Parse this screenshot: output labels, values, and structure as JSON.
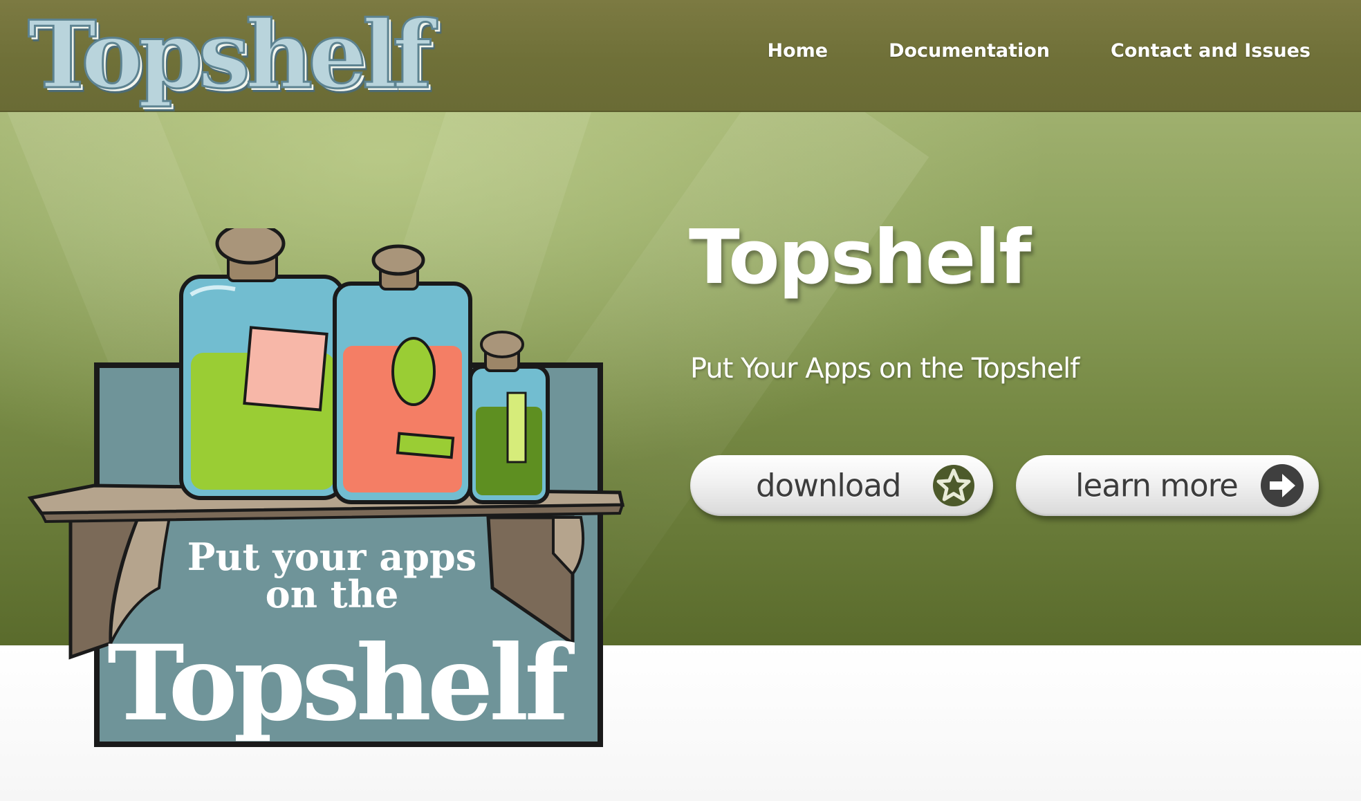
{
  "header": {
    "logo_text": "Topshelf",
    "nav": [
      {
        "label": "Home",
        "active": true
      },
      {
        "label": "Documentation",
        "active": false
      },
      {
        "label": "Contact and Issues",
        "active": false
      }
    ]
  },
  "hero": {
    "title": "Topshelf",
    "subtitle": "Put Your Apps on the Topshelf",
    "buttons": {
      "download": {
        "label": "download",
        "icon": "star-icon"
      },
      "learn_more": {
        "label": "learn more",
        "icon": "arrow-right-icon"
      }
    },
    "illustration": {
      "sign_lines": [
        "Put your apps",
        "on the",
        "Topshelf"
      ]
    }
  },
  "colors": {
    "header_bg": "#6f7038",
    "hero_top": "#9fb06e",
    "hero_bottom": "#5a6b2c",
    "logo_fill": "#b9d4dc",
    "sign_bg": "#6f9499"
  }
}
